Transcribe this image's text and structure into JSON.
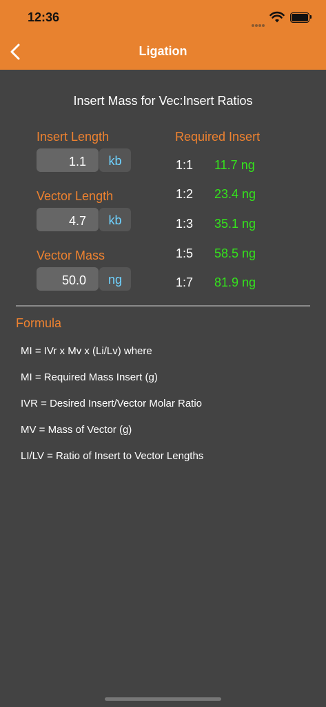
{
  "status_bar": {
    "time": "12:36"
  },
  "nav": {
    "title": "Ligation",
    "back_icon": "chevron-left-icon"
  },
  "header": {
    "title": "Insert Mass for Vec:Insert Ratios"
  },
  "inputs": [
    {
      "label": "Insert Length",
      "value": "1.1",
      "unit": "kb"
    },
    {
      "label": "Vector Length",
      "value": "4.7",
      "unit": "kb"
    },
    {
      "label": "Vector Mass",
      "value": "50.0",
      "unit": "ng"
    }
  ],
  "results": {
    "title": "Required Insert",
    "rows": [
      {
        "ratio": "1:1",
        "mass": "11.7 ng"
      },
      {
        "ratio": "1:2",
        "mass": "23.4 ng"
      },
      {
        "ratio": "1:3",
        "mass": "35.1 ng"
      },
      {
        "ratio": "1:5",
        "mass": "58.5 ng"
      },
      {
        "ratio": "1:7",
        "mass": "81.9 ng"
      }
    ]
  },
  "formula": {
    "title": "Formula",
    "lines": [
      "MI = IVr x Mv x (Li/Lv)  where",
      "MI = Required Mass Insert (g)",
      "IVR = Desired Insert/Vector Molar Ratio",
      "MV = Mass of Vector (g)",
      "LI/LV = Ratio of Insert to Vector Lengths"
    ]
  },
  "colors": {
    "accent": "#e8822f",
    "background": "#434343",
    "result": "#34e31c",
    "unit": "#6fd2ff"
  }
}
